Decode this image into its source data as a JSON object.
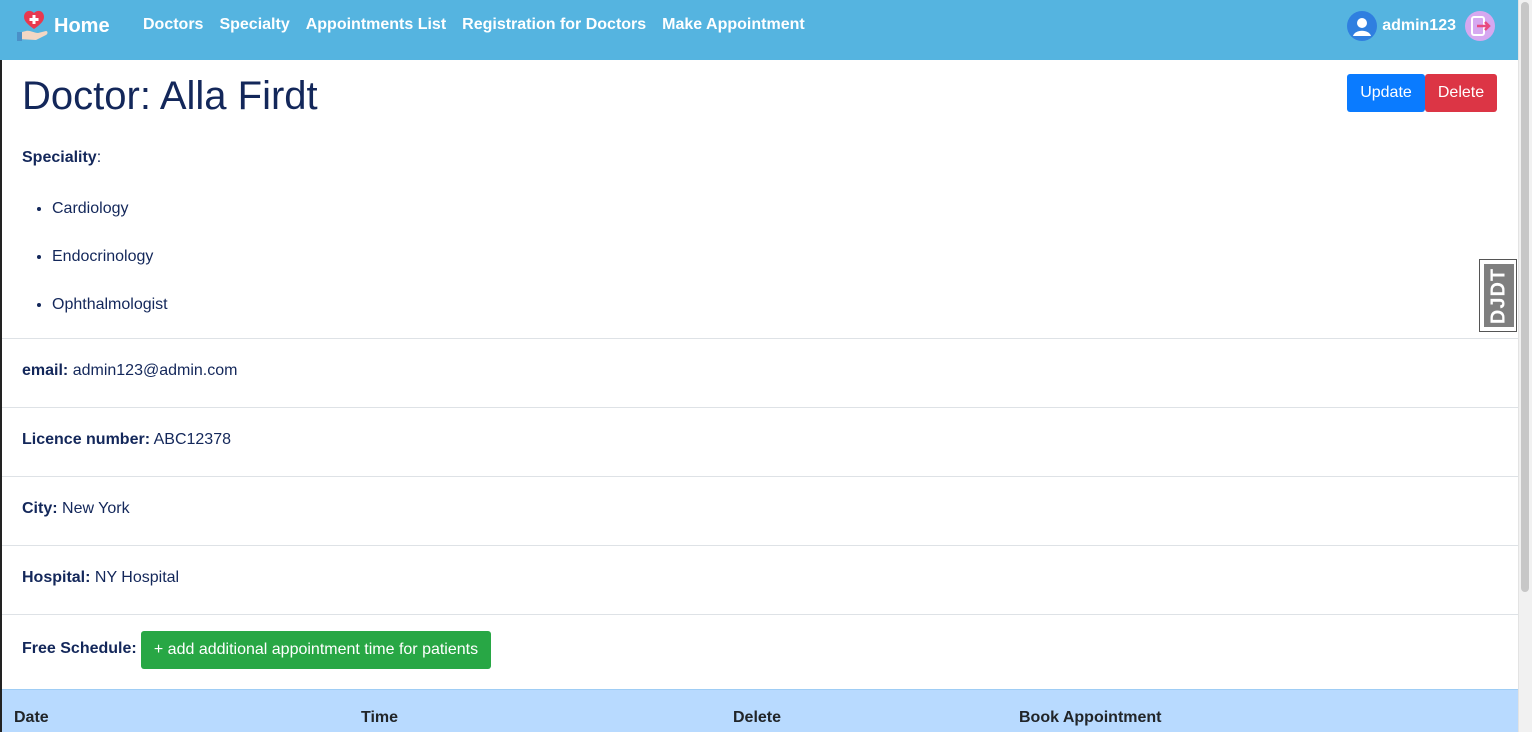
{
  "navbar": {
    "brand_label": "Home",
    "links": [
      "Doctors",
      "Specialty",
      "Appointments List",
      "Registration for Doctors",
      "Make Appointment"
    ],
    "username": "admin123"
  },
  "doctor": {
    "title": "Doctor: Alla Firdt",
    "speciality_label": "Speciality",
    "specialities": [
      "Cardiology",
      "Endocrinology",
      "Ophthalmologist"
    ],
    "email_label": "email:",
    "email": "admin123@admin.com",
    "licence_label": "Licence number:",
    "licence": "ABC12378",
    "city_label": "City:",
    "city": "New York",
    "hospital_label": "Hospital:",
    "hospital": "NY Hospital",
    "schedule_label": "Free Schedule:"
  },
  "actions": {
    "update_label": "Update",
    "delete_label": "Delete",
    "add_time_label": "+ add additional appointment time for patients"
  },
  "table": {
    "headers": [
      "Date",
      "Time",
      "Delete",
      "Book Appointment"
    ]
  },
  "debug_toolbar": {
    "label": "DJDT"
  },
  "colors": {
    "navbar": "#55b4e0",
    "primary": "#0a7bff",
    "danger": "#dc3545",
    "success": "#28a745",
    "table_header": "#b8daff",
    "text": "#13275a"
  }
}
